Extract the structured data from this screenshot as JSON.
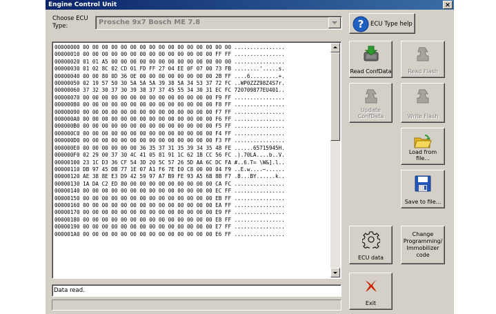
{
  "window": {
    "title": "Engine Control Unit",
    "close_label": "×"
  },
  "ecu_type": {
    "label": "Choose ECU Type:",
    "selected": "Prosche 9x7 Bosch ME 7.8"
  },
  "buttons": {
    "ecu_type_help": "ECU Type help",
    "read_confdata": "Read ConfData",
    "read_flash": "Read Flash",
    "update_confdata": "Update ConfData",
    "write_flash": "Write Flash",
    "load_from_file": "Load from file...",
    "save_to_file": "Save to file...",
    "ecu_data": "ECU data",
    "change_programming": "Change Programming/ Immobilizer code",
    "exit": "Exit"
  },
  "hex_dump": [
    "00000000 00 00 00 00 00 00 00 00 00 00 00 00 00 00 00 00 ................",
    "00000010 00 00 00 00 00 00 00 00 00 00 00 00 00 00 FF FF ................",
    "00000020 01 01 A5 00 00 00 00 00 00 00 00 00 00 00 00 00 ................",
    "00000030 01 02 8C 02 CD 01 FD FF 27 04 EE 0F 07 00 73 FB ........'.....s.",
    "00000040 00 00 80 0D 36 0E 00 00 00 00 00 00 00 00 2B FF ....6.........+.",
    "00000050 02 19 57 50 30 5A 5A 5A 39 38 5A 34 53 37 72 FC ..WP0ZZZ98Z4S7r.",
    "00000060 37 32 30 37 30 39 38 37 37 45 55 34 30 31 EC FC 720709877EU401..",
    "00000070 00 00 00 00 00 00 00 00 00 00 00 00 00 00 F9 FF ................",
    "00000080 00 00 00 00 00 00 00 00 00 00 00 00 00 00 F8 FF ................",
    "00000090 00 00 00 00 00 00 00 00 00 00 00 00 00 00 F7 FF ................",
    "000000A0 00 00 00 00 00 00 00 00 00 00 00 00 00 00 F6 FF ................",
    "000000B0 00 00 00 00 00 00 00 00 00 00 00 00 00 00 F5 FF ................",
    "000000C0 00 00 00 00 00 00 00 00 00 00 00 00 00 00 F4 FF ................",
    "000000D0 00 00 00 00 00 00 00 00 00 00 00 00 00 00 F3 FF ................",
    "000000E0 00 00 00 00 00 00 36 35 37 31 35 39 34 35 48 FE ......65715945H.",
    "000000F0 02 29 00 37 30 4C 41 05 81 91 1C 62 1B CC 56 FC .).70LA....b..V.",
    "00000100 23 1C D3 36 CF 54 3D 20 5C 57 26 5D AA 6C DC FA #..6.T= \\W&].l..",
    "00000110 DB 97 45 DB 77 1E 07 A1 F6 7E E0 C8 00 00 04 F9 ..E.w....~......",
    "00000120 AE 38 8E E3 D9 42 59 97 A7 B9 FE 93 A5 6B 8B F7 .8...BY......k..",
    "00000130 1A DA C2 ED 80 00 00 00 00 00 00 00 00 00 CA FC ................",
    "00000140 00 00 00 00 00 00 00 00 00 00 00 00 00 00 EC FF ................",
    "00000150 00 00 00 00 00 00 00 00 00 00 00 00 00 00 EB FF ................",
    "00000160 00 00 00 00 00 00 00 00 00 00 00 00 00 00 EA FF ................",
    "00000170 00 00 00 00 00 00 00 00 00 00 00 00 00 00 E9 FF ................",
    "00000180 00 00 00 00 00 00 00 00 00 00 00 00 00 00 E8 FF ................",
    "00000190 00 00 00 00 00 00 00 00 00 00 00 00 00 00 E7 FF ................",
    "000001A0 00 00 00 00 00 00 00 00 00 00 00 00 00 00 E6 FF ................"
  ],
  "status": {
    "text": "Data read."
  },
  "icons": {
    "help": "question-icon",
    "read_confdata": "chip-download-icon",
    "read_flash": "chip-icon",
    "update_confdata": "chip-icon",
    "write_flash": "chip-icon",
    "load_from_file": "folder-open-icon",
    "save_to_file": "floppy-disk-icon",
    "ecu_data": "gear-icon",
    "exit": "red-x-icon"
  },
  "colors": {
    "titlebar": "#0a246a",
    "face": "#d4d0c8",
    "help_icon": "#1f5fbf",
    "exit_icon": "#cc2200"
  }
}
